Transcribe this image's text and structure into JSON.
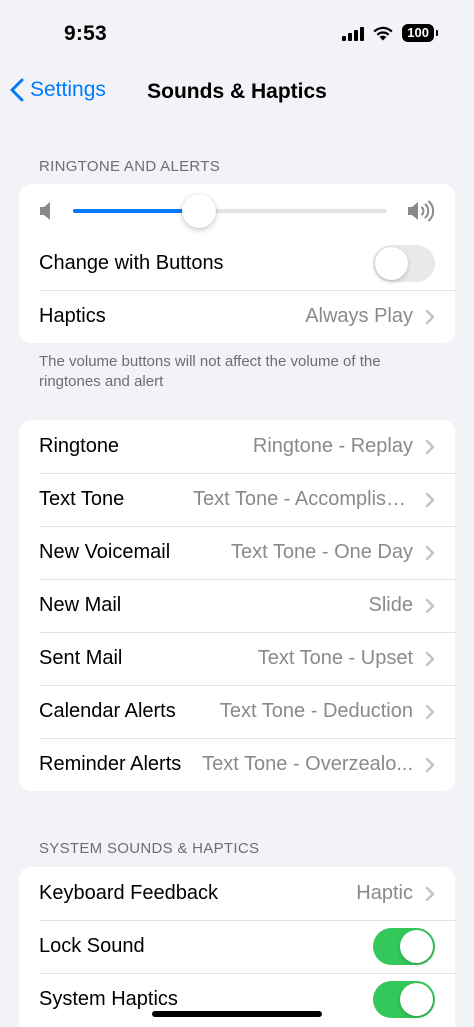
{
  "status": {
    "time": "9:53",
    "battery": "100"
  },
  "nav": {
    "back_label": "Settings",
    "title": "Sounds & Haptics"
  },
  "ringtone_section": {
    "header": "RINGTONE AND ALERTS",
    "volume_level": 0.4,
    "change_with_buttons": {
      "label": "Change with Buttons",
      "on": false
    },
    "haptics": {
      "label": "Haptics",
      "value": "Always Play"
    },
    "footer": "The volume buttons will not affect the volume of the ringtones and alert"
  },
  "tones": [
    {
      "label": "Ringtone",
      "value": "Ringtone - Replay"
    },
    {
      "label": "Text Tone",
      "value": "Text Tone - Accomplished"
    },
    {
      "label": "New Voicemail",
      "value": "Text Tone - One Day"
    },
    {
      "label": "New Mail",
      "value": "Slide"
    },
    {
      "label": "Sent Mail",
      "value": "Text Tone - Upset"
    },
    {
      "label": "Calendar Alerts",
      "value": "Text Tone - Deduction"
    },
    {
      "label": "Reminder Alerts",
      "value": "Text Tone - Overzealo..."
    }
  ],
  "system_section": {
    "header": "SYSTEM SOUNDS & HAPTICS",
    "keyboard_feedback": {
      "label": "Keyboard Feedback",
      "value": "Haptic"
    },
    "lock_sound": {
      "label": "Lock Sound",
      "on": true
    },
    "system_haptics": {
      "label": "System Haptics",
      "on": true
    }
  },
  "colors": {
    "accent": "#007aff",
    "toggle_on": "#34c759",
    "background": "#f2f2f7"
  }
}
